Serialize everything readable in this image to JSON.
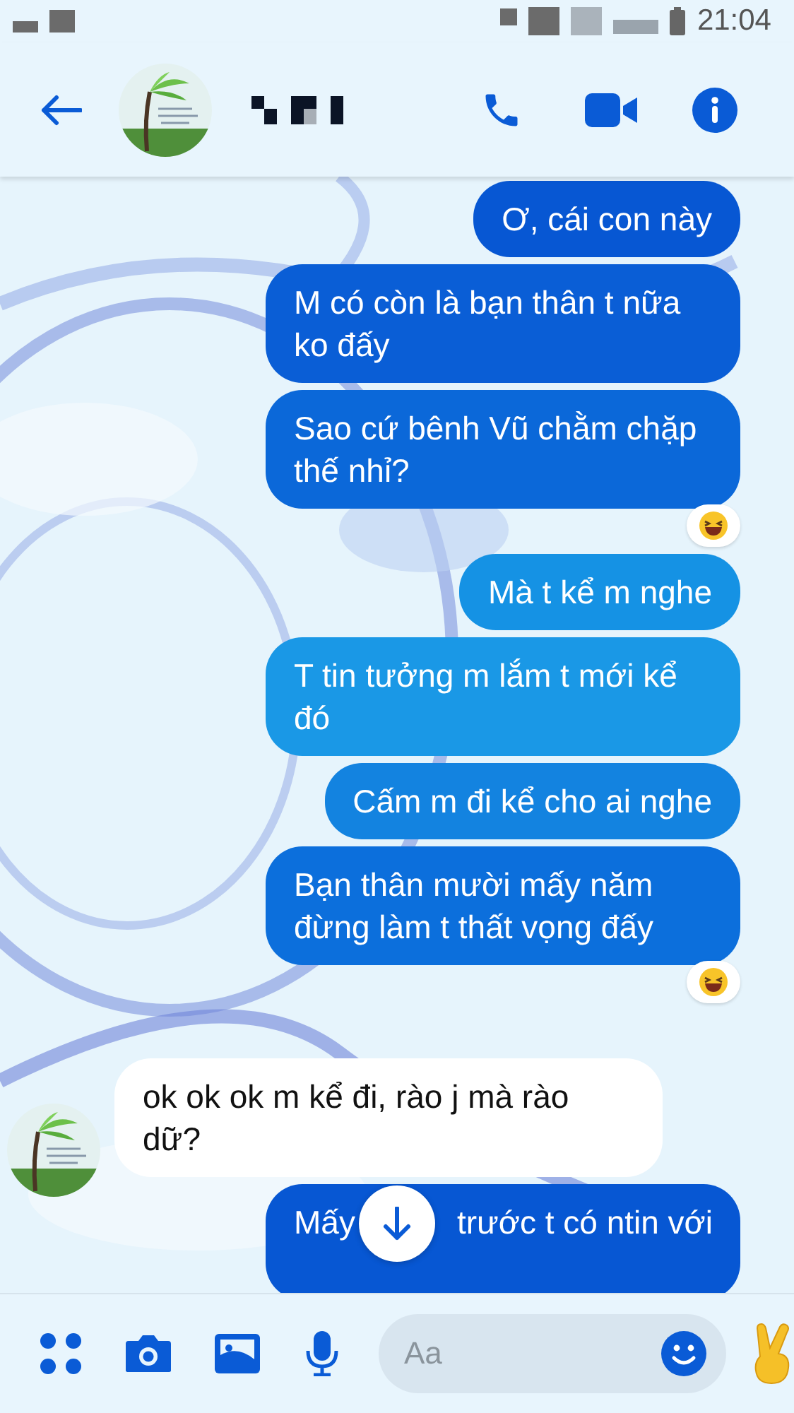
{
  "status_bar": {
    "time": "21:04"
  },
  "messages": [
    {
      "kind": "outgoing",
      "text": "Ơ, cái con này",
      "color": "#0757d3",
      "reaction": false
    },
    {
      "kind": "outgoing",
      "text": "M có còn là bạn thân t nữa ko đấy",
      "color": "#0a5ed6",
      "reaction": false
    },
    {
      "kind": "outgoing",
      "text": "Sao cứ bênh Vũ chằm chặp thế nhỉ?",
      "color": "#0b68d9",
      "reaction": true
    },
    {
      "kind": "outgoing",
      "text": "Mà t kể m nghe",
      "color": "#1592e4",
      "reaction": false
    },
    {
      "kind": "outgoing",
      "text": "T tin tưởng m lắm t mới kể đó",
      "color": "#1a98e6",
      "reaction": false
    },
    {
      "kind": "outgoing",
      "text": "Cấm m đi kể cho ai nghe",
      "color": "#1383e0",
      "reaction": false
    },
    {
      "kind": "outgoing",
      "text": "Bạn thân mười mấy năm đừng làm t thất vọng đấy",
      "color": "#0c6fdc",
      "reaction": true
    },
    {
      "kind": "incoming",
      "text": "ok ok ok m kể đi, rào j mà rào dữ?",
      "color": "#ffffff",
      "reaction": false
    },
    {
      "kind": "outgoing",
      "text": "Mấy",
      "tail": "trước t có ntin với",
      "color": "#0757d3",
      "reaction": false
    }
  ],
  "composer": {
    "placeholder": "Aa"
  }
}
